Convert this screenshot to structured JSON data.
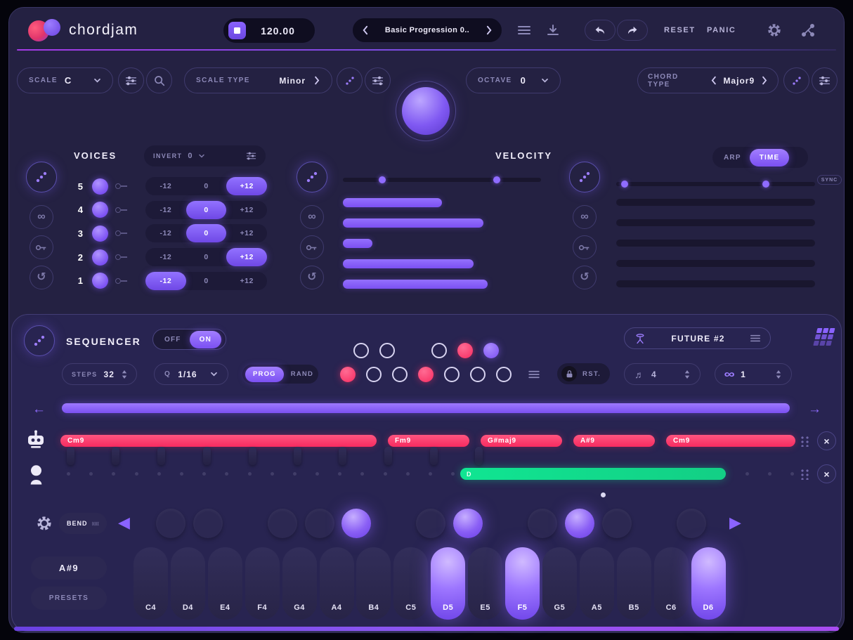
{
  "glyphs": {
    "infinity": "∞",
    "refresh": "↺",
    "note": "♬",
    "close": "×",
    "tri_left": "◀",
    "tri_right": "▶",
    "arrow_left": "←",
    "arrow_right": "→"
  },
  "header": {
    "logo": "chordjam",
    "bpm": "120.00",
    "preset": "Basic Progression 0..",
    "reset": "RESET",
    "panic": "PANIC"
  },
  "controls": {
    "scale_label": "SCALE",
    "scale_value": "C",
    "scale_type_label": "SCALE TYPE",
    "scale_type_value": "Minor",
    "octave_label": "OCTAVE",
    "octave_value": "0",
    "chord_type_label": "CHORD TYPE",
    "chord_type_value": "Major9"
  },
  "voices": {
    "title": "VOICES",
    "invert_label": "INVERT",
    "invert_value": "0",
    "options": [
      "-12",
      "0",
      "+12"
    ],
    "rows": [
      {
        "num": "5",
        "selected": "+12"
      },
      {
        "num": "4",
        "selected": "0"
      },
      {
        "num": "3",
        "selected": "0"
      },
      {
        "num": "2",
        "selected": "+12"
      },
      {
        "num": "1",
        "selected": "-12"
      }
    ]
  },
  "velocity": {
    "title": "VELOCITY",
    "bars_pct": [
      50,
      71,
      15,
      66,
      73
    ],
    "slider_handles_pct": [
      18,
      76
    ]
  },
  "timing": {
    "arp": "ARP",
    "time": "TIME",
    "active": "TIME",
    "sync": "SYNC",
    "slider_handles_pct": [
      2.5,
      73.5
    ],
    "bars": 5
  },
  "sequencer": {
    "title": "SEQUENCER",
    "off": "OFF",
    "on": "ON",
    "power": "ON",
    "steps_label": "STEPS",
    "steps_value": "32",
    "quantize_label": "Q",
    "quantize_value": "1/16",
    "prog": "PROG",
    "rand": "RAND",
    "mode": "PROG",
    "rst": "RST.",
    "bars_value": "4",
    "loop_value": "1",
    "preset": "FUTURE #2",
    "step_dots_top": [
      "outline",
      "outline",
      "none",
      "outline",
      "pink",
      "purple"
    ],
    "step_dots_bottom": [
      "pink",
      "outline",
      "outline",
      "pink",
      "outline",
      "outline",
      "outline"
    ],
    "chords": [
      {
        "label": "Cm9",
        "left_pct": 0,
        "width_pct": 43.0
      },
      {
        "label": "Fm9",
        "left_pct": 44.55,
        "width_pct": 11.1
      },
      {
        "label": "G#maj9",
        "left_pct": 57.17,
        "width_pct": 11.1
      },
      {
        "label": "A#9",
        "left_pct": 69.79,
        "width_pct": 11.1
      },
      {
        "label": "Cm9",
        "left_pct": 82.41,
        "width_pct": 17.6
      }
    ],
    "handles_pct": [
      0.9,
      7.0,
      13.2,
      19.4,
      25.6,
      31.7,
      37.9,
      44.1,
      50.3,
      56.4
    ],
    "note_bar": {
      "label": "D",
      "left_pct": 54.4,
      "width_pct": 36.1
    },
    "dot_count": 33
  },
  "keyboard": {
    "bend": "BEND",
    "chord": "A#9",
    "presets": "PRESETS",
    "keys": [
      {
        "label": "C4",
        "lit": false
      },
      {
        "label": "D4",
        "lit": false
      },
      {
        "label": "E4",
        "lit": false
      },
      {
        "label": "F4",
        "lit": false
      },
      {
        "label": "G4",
        "lit": false
      },
      {
        "label": "A4",
        "lit": false
      },
      {
        "label": "B4",
        "lit": false
      },
      {
        "label": "C5",
        "lit": false
      },
      {
        "label": "D5",
        "lit": true
      },
      {
        "label": "E5",
        "lit": false
      },
      {
        "label": "F5",
        "lit": true
      },
      {
        "label": "G5",
        "lit": false
      },
      {
        "label": "A5",
        "lit": false
      },
      {
        "label": "B5",
        "lit": false
      },
      {
        "label": "C6",
        "lit": false
      },
      {
        "label": "D6",
        "lit": true
      }
    ],
    "pads": [
      {
        "note": "C#4",
        "after": 0,
        "lit": false
      },
      {
        "note": "D#4",
        "after": 1,
        "lit": false
      },
      {
        "note": "F#4",
        "after": 3,
        "lit": false
      },
      {
        "note": "G#4",
        "after": 4,
        "lit": false
      },
      {
        "note": "A#4",
        "after": 5,
        "lit": true
      },
      {
        "note": "C#5",
        "after": 7,
        "lit": false
      },
      {
        "note": "D#5",
        "after": 8,
        "lit": true
      },
      {
        "note": "F#5",
        "after": 10,
        "lit": false
      },
      {
        "note": "G#5",
        "after": 11,
        "lit": true
      },
      {
        "note": "A#5",
        "after": 12,
        "lit": false
      },
      {
        "note": "C#6",
        "after": 14,
        "lit": false
      }
    ]
  }
}
